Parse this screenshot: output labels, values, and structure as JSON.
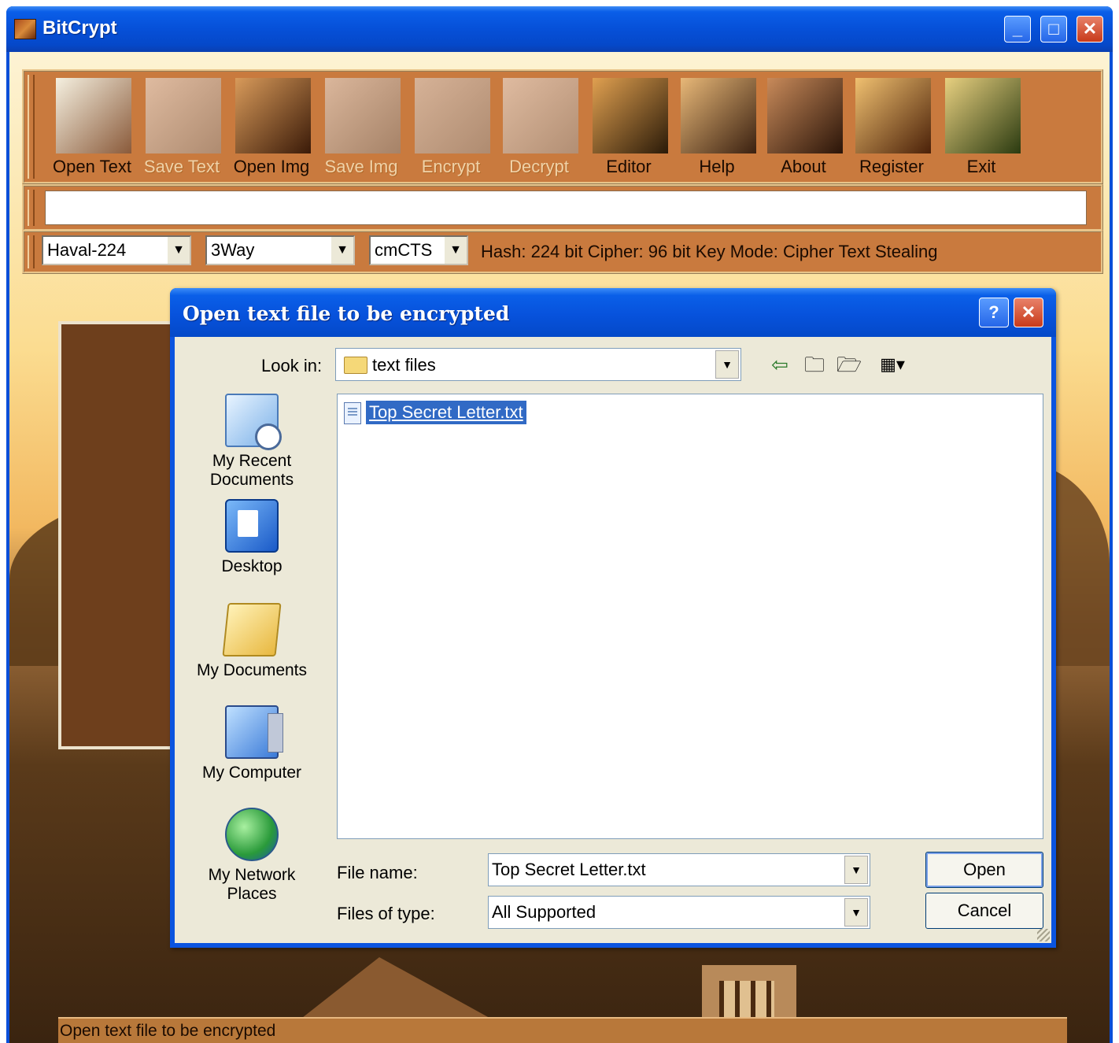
{
  "window": {
    "title": "BitCrypt",
    "min_glyph": "_",
    "max_glyph": "□",
    "close_glyph": "✕"
  },
  "toolbar": {
    "items": [
      {
        "label": "Open Text",
        "icon": "open-text-icon",
        "enabled": true,
        "colors": [
          "#f5f0e0",
          "#8a5a3a"
        ]
      },
      {
        "label": "Save Text",
        "icon": "save-text-icon",
        "enabled": false,
        "colors": [
          "#f0f0f0",
          "#9a9a9a"
        ]
      },
      {
        "label": "Open Img",
        "icon": "open-img-icon",
        "enabled": true,
        "colors": [
          "#d89a5a",
          "#3a1a08"
        ]
      },
      {
        "label": "Save Img",
        "icon": "save-img-icon",
        "enabled": false,
        "colors": [
          "#e8e8e8",
          "#8a8a8a"
        ]
      },
      {
        "label": "Encrypt",
        "icon": "encrypt-icon",
        "enabled": false,
        "colors": [
          "#e0e0e0",
          "#9a9a9a"
        ]
      },
      {
        "label": "Decrypt",
        "icon": "decrypt-icon",
        "enabled": false,
        "colors": [
          "#f0f0f0",
          "#a0a0a0"
        ]
      },
      {
        "label": "Editor",
        "icon": "editor-icon",
        "enabled": true,
        "colors": [
          "#e0a050",
          "#2a1a08"
        ]
      },
      {
        "label": "Help",
        "icon": "help-icon",
        "enabled": true,
        "colors": [
          "#e8b878",
          "#3a2010"
        ]
      },
      {
        "label": "About",
        "icon": "about-icon",
        "enabled": true,
        "colors": [
          "#c88a5a",
          "#2a1408"
        ]
      },
      {
        "label": "Register",
        "icon": "register-icon",
        "enabled": true,
        "colors": [
          "#f0c070",
          "#4a2008"
        ]
      },
      {
        "label": "Exit",
        "icon": "exit-icon",
        "enabled": true,
        "colors": [
          "#e8d080",
          "#2a3a10"
        ]
      }
    ]
  },
  "text_input": {
    "value": ""
  },
  "options": {
    "hash": "Haval-224",
    "cipher": "3Way",
    "mode": "cmCTS",
    "info": "Hash: 224 bit  Cipher: 96 bit Key Mode: Cipher Text Stealing"
  },
  "status": "Open text file to be encrypted",
  "dialog": {
    "title": "Open text file to be encrypted",
    "help_glyph": "?",
    "close_glyph": "✕",
    "look_in_label": "Look in:",
    "look_in_value": "text files",
    "nav_icons": [
      "back-arrow-icon",
      "up-folder-icon",
      "new-folder-icon",
      "view-menu-icon"
    ],
    "places": [
      {
        "label": "My Recent Documents",
        "icon": "recent-documents-icon"
      },
      {
        "label": "Desktop",
        "icon": "desktop-icon"
      },
      {
        "label": "My Documents",
        "icon": "my-documents-icon"
      },
      {
        "label": "My Computer",
        "icon": "my-computer-icon"
      },
      {
        "label": "My Network Places",
        "icon": "network-places-icon"
      }
    ],
    "files": [
      {
        "name": "Top Secret Letter.txt",
        "icon": "text-file-icon",
        "selected": true
      }
    ],
    "file_name_label": "File name:",
    "file_name_value": "Top Secret Letter.txt",
    "file_type_label": "Files of type:",
    "file_type_value": "All Supported",
    "open_label": "Open",
    "cancel_label": "Cancel"
  }
}
